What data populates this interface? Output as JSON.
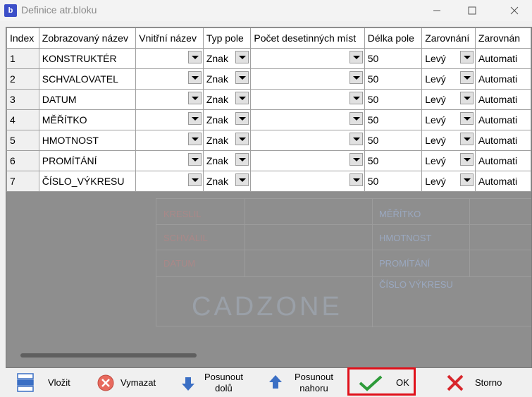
{
  "window": {
    "title": "Definice atr.bloku",
    "app_icon_glyph": "b"
  },
  "grid": {
    "headers": [
      "Index",
      "Zobrazovaný název",
      "Vnitřní název",
      "Typ pole",
      "Počet desetinných míst",
      "Délka pole",
      "Zarovnání",
      "Zarovnán"
    ],
    "rows": [
      {
        "index": "1",
        "name": "KONSTRUKTÉR",
        "internal": "",
        "type": "Znak",
        "decimals": "",
        "length": "50",
        "align": "Levý",
        "align2": "Automati"
      },
      {
        "index": "2",
        "name": "SCHVALOVATEL",
        "internal": "",
        "type": "Znak",
        "decimals": "",
        "length": "50",
        "align": "Levý",
        "align2": "Automati"
      },
      {
        "index": "3",
        "name": "DATUM",
        "internal": "",
        "type": "Znak",
        "decimals": "",
        "length": "50",
        "align": "Levý",
        "align2": "Automati"
      },
      {
        "index": "4",
        "name": "MĚŘÍTKO",
        "internal": "",
        "type": "Znak",
        "decimals": "",
        "length": "50",
        "align": "Levý",
        "align2": "Automati"
      },
      {
        "index": "5",
        "name": "HMOTNOST",
        "internal": "",
        "type": "Znak",
        "decimals": "",
        "length": "50",
        "align": "Levý",
        "align2": "Automati"
      },
      {
        "index": "6",
        "name": "PROMÍTÁNÍ",
        "internal": "",
        "type": "Znak",
        "decimals": "",
        "length": "50",
        "align": "Levý",
        "align2": "Automati"
      },
      {
        "index": "7",
        "name": "ČÍSLO_VÝKRESU",
        "internal": "",
        "type": "Znak",
        "decimals": "",
        "length": "50",
        "align": "Levý",
        "align2": "Automati"
      }
    ]
  },
  "preview": {
    "left_labels": [
      "KRESLIL",
      "SCHVÁLIL",
      "DATUM"
    ],
    "right_labels": [
      "MĚŘÍTKO",
      "HMOTNOST",
      "PROMÍTÁNÍ",
      "ČÍSLO VÝKRESU"
    ],
    "logo": "CADZONE"
  },
  "toolbar": {
    "insert": "Vložit",
    "delete": "Vymazat",
    "move_down_1": "Posunout",
    "move_down_2": "dolů",
    "move_up_1": "Posunout",
    "move_up_2": "nahoru",
    "ok": "OK",
    "cancel": "Storno"
  },
  "colors": {
    "highlight": "#e0101a",
    "ok_check": "#2e9b3a",
    "cancel_x": "#d8262c",
    "arrow_blue": "#3b6fc4"
  }
}
